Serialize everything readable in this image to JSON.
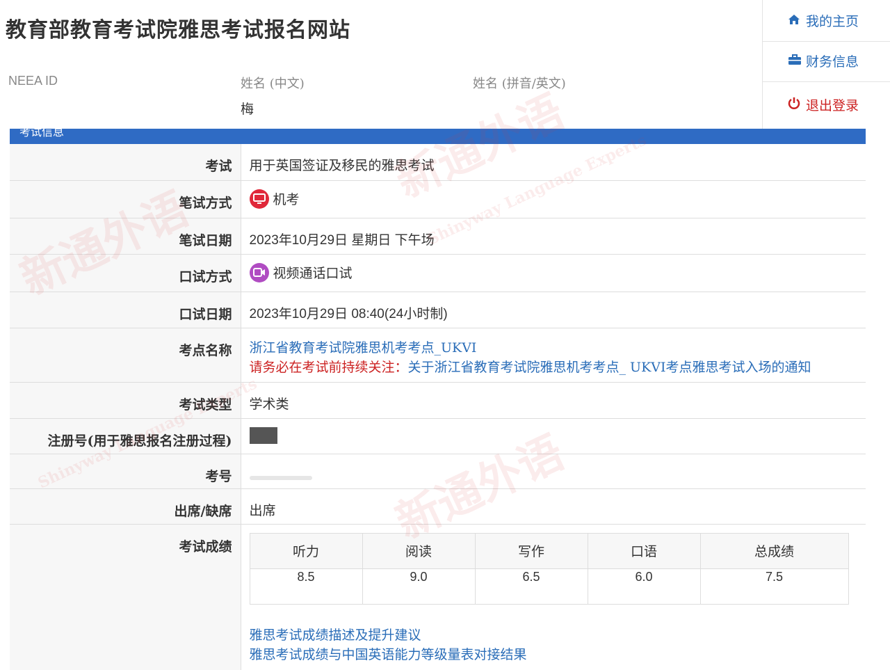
{
  "header": {
    "site_title": "教育部教育考试院雅思考试报名网站",
    "neea_id_label": "NEEA ID",
    "name_cn_label": "姓名 (中文)",
    "name_cn_value": "梅",
    "name_en_label": "姓名 (拼音/英文)"
  },
  "nav": {
    "home": "我的主页",
    "finance": "财务信息",
    "logout": "退出登录"
  },
  "section": {
    "title": "考试信息"
  },
  "rows": {
    "exam_label": "考试",
    "exam_value": "用于英国签证及移民的雅思考试",
    "written_mode_label": "笔试方式",
    "written_mode_value": "机考",
    "written_date_label": "笔试日期",
    "written_date_value": "2023年10月29日 星期日  下午场",
    "speaking_mode_label": "口试方式",
    "speaking_mode_value": "视频通话口试",
    "speaking_date_label": "口试日期",
    "speaking_date_value": "2023年10月29日 08:40(24小时制)",
    "center_label": "考点名称",
    "center_link": "浙江省教育考试院雅思机考考点_UKVI",
    "center_notice_prefix": "请务必在考试前持续关注：",
    "center_notice_link": "关于浙江省教育考试院雅思机考考点_ UKVI考点雅思考试入场的通知",
    "type_label": "考试类型",
    "type_value": "学术类",
    "reg_label": "注册号(用于雅思报名注册过程)",
    "candidate_label": "考号",
    "attendance_label": "出席/缺席",
    "attendance_value": "出席",
    "scores_label": "考试成绩"
  },
  "scores": {
    "headers": [
      "听力",
      "阅读",
      "写作",
      "口语",
      "总成绩"
    ],
    "values": [
      "8.5",
      "9.0",
      "6.5",
      "6.0",
      "7.5"
    ]
  },
  "links": {
    "score_desc": "雅思考试成绩描述及提升建议",
    "score_cse": "雅思考试成绩与中国英语能力等级量表对接结果"
  },
  "watermark": {
    "cn": "新通外语",
    "en": "Shinyway Language Experts"
  },
  "colors": {
    "accent_blue": "#2f6bc4",
    "link_blue": "#2a6db8",
    "warn_red": "#cc2222"
  }
}
